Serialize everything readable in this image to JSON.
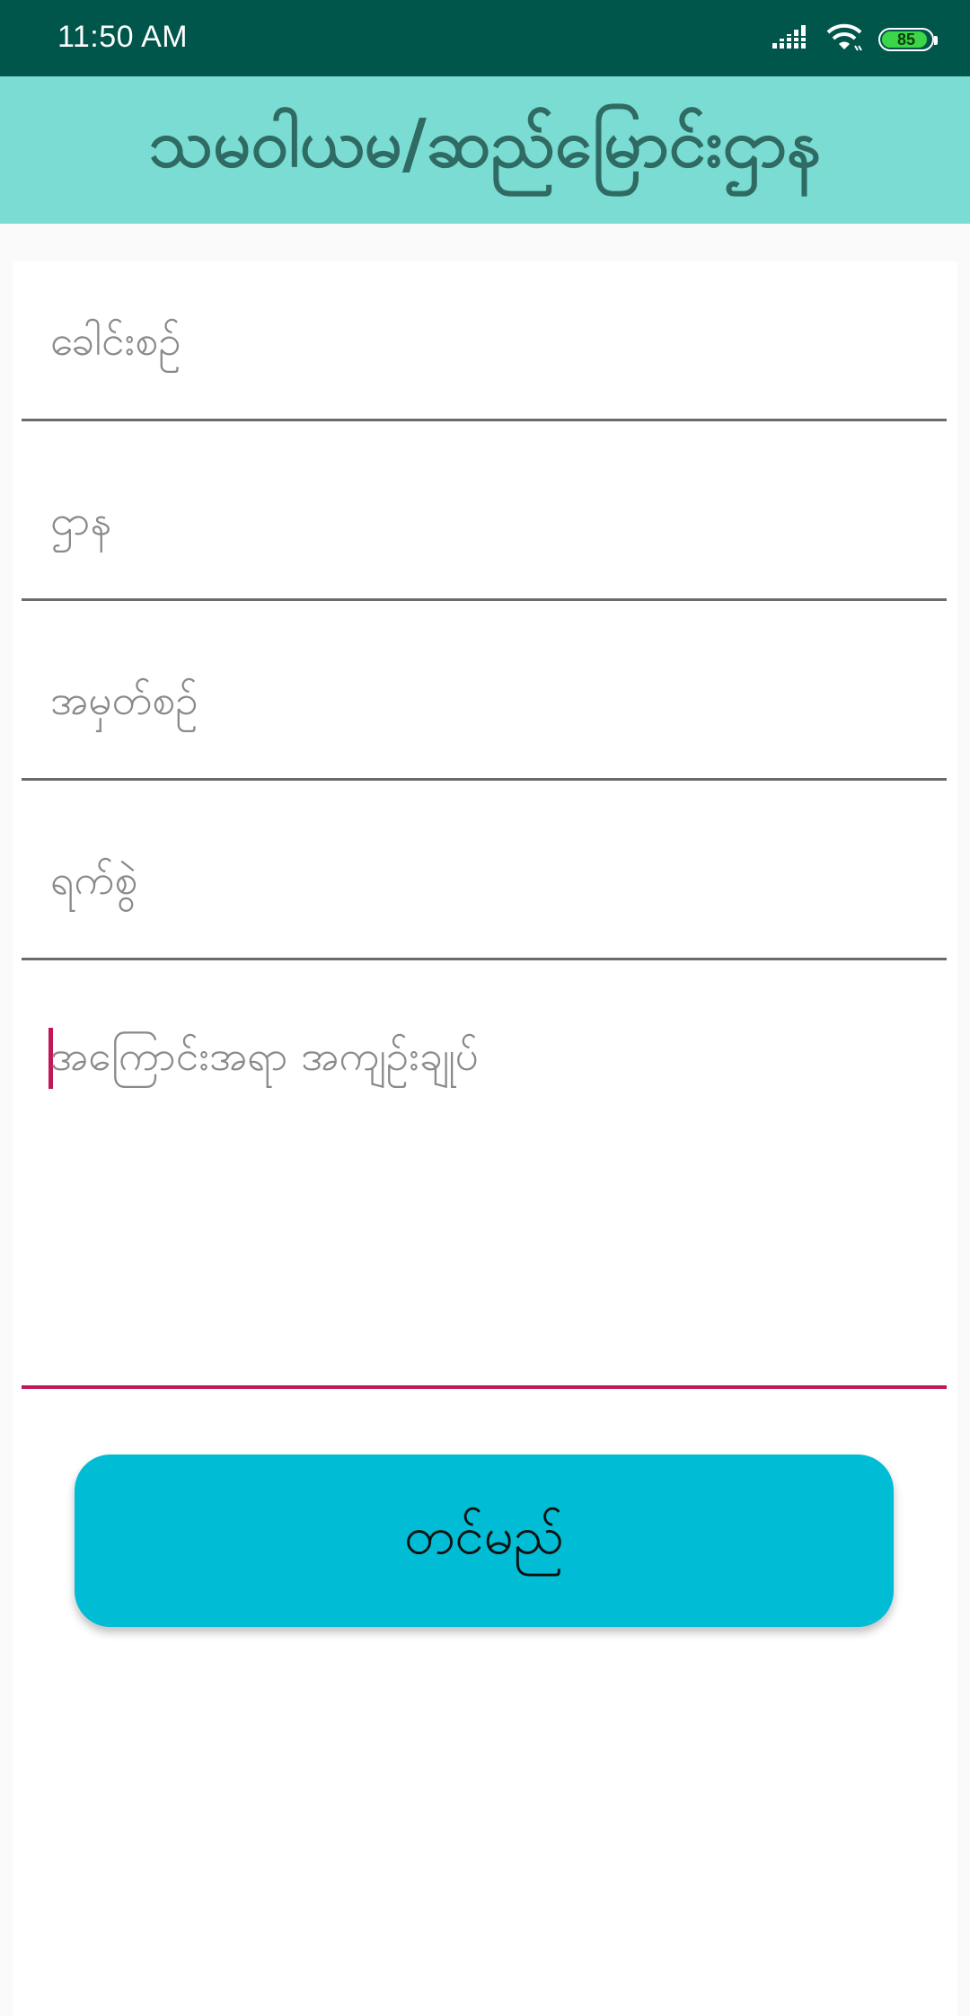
{
  "status_bar": {
    "time": "11:50 AM",
    "battery_level": "85",
    "icons": [
      "signal-icon",
      "wifi-icon",
      "battery-icon"
    ]
  },
  "header": {
    "title": "သမဝါယမ/ဆည်မြောင်းဌာန"
  },
  "form": {
    "fields": [
      {
        "placeholder": "ခေါင်းစဉ်"
      },
      {
        "placeholder": "ဌာန"
      },
      {
        "placeholder": "အမှတ်စဉ်"
      },
      {
        "placeholder": "ရက်စွဲ"
      },
      {
        "placeholder": "အကြောင်းအရာ အကျဉ်းချုပ်"
      }
    ],
    "submit_label": "တင်မည်"
  },
  "colors": {
    "status_bar": "#00564a",
    "header": "#7adcd2",
    "header_text": "#2f6b63",
    "accent": "#c2185b",
    "button": "#00bcd4"
  }
}
